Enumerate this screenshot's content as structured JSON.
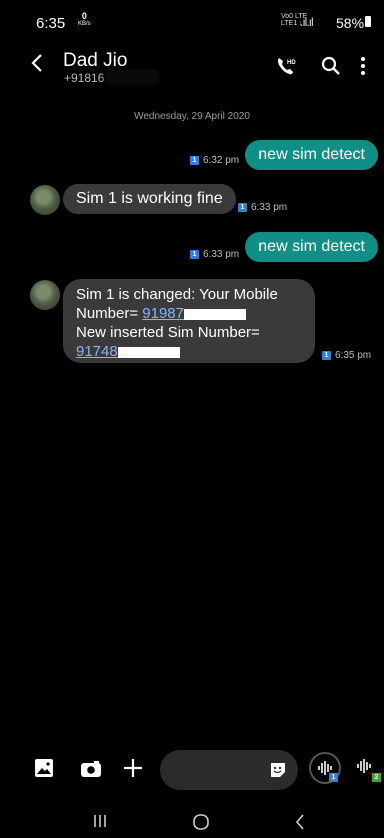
{
  "status_bar": {
    "time": "6:35",
    "net_speed_value": "0",
    "net_speed_unit": "KB/s",
    "network": "VoLTE LTE1",
    "battery": "58%"
  },
  "header": {
    "title": "Dad Jio",
    "subtitle": "+91816"
  },
  "conversation": {
    "date_divider": "Wednesday, 29 April 2020",
    "messages": [
      {
        "direction": "outgoing",
        "text": "new sim detect",
        "time": "6:32 pm",
        "sim": "1"
      },
      {
        "direction": "incoming",
        "text": "Sim 1 is working fine",
        "time": "6:33 pm",
        "sim": "1"
      },
      {
        "direction": "outgoing",
        "text": "new sim detect",
        "time": "6:33 pm",
        "sim": "1"
      },
      {
        "direction": "incoming",
        "line1": "Sim 1 is changed: Your Mobile",
        "line2_prefix": "Number= ",
        "line2_link": "91987",
        "line3": "New inserted Sim Number=",
        "line4_link": "91748",
        "time": "6:35 pm",
        "sim": "1"
      }
    ]
  },
  "composer": {
    "voice_sim1": "1",
    "voice_sim2": "2"
  },
  "colors": {
    "outgoing_bubble": "#108f86",
    "incoming_bubble": "#3a3a3a",
    "link": "#8ab4f8",
    "sim_badge": "#2f7fe0"
  }
}
